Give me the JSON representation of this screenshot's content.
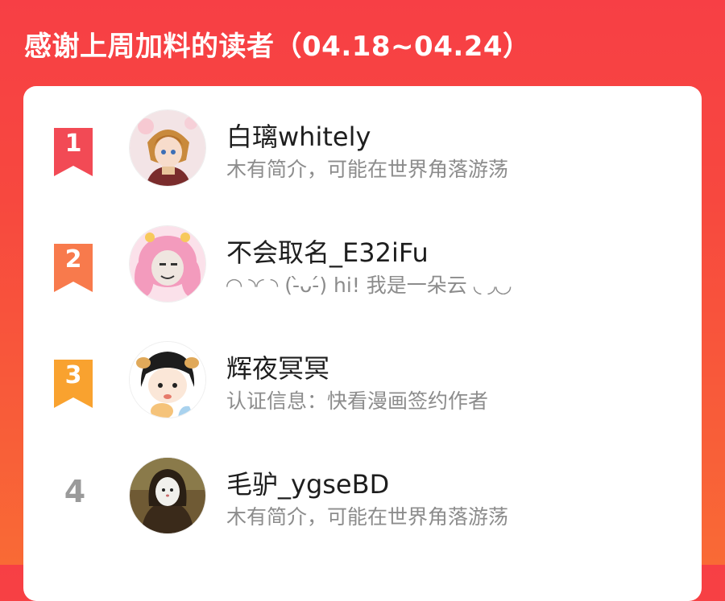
{
  "header": {
    "title": "感谢上周加料的读者（04.18~04.24）"
  },
  "colors": {
    "rank1": "#f24a55",
    "rank2": "#f87a4c",
    "rank3": "#f9a22f",
    "rank_plain": "#9a9a9a"
  },
  "readers": [
    {
      "rank": "1",
      "name": "白璃whitely",
      "desc": "木有简介，可能在世界角落游荡",
      "avatar_icon": "anime-boy-avatar"
    },
    {
      "rank": "2",
      "name": "不会取名_E32iFu",
      "desc": "◜◝ ◝◜ ◝ (-̀ᴗ-́) hi! 我是一朵云 ◟ ◞◟◞",
      "avatar_icon": "pink-meme-face-avatar"
    },
    {
      "rank": "3",
      "name": "辉夜冥冥",
      "desc": "认证信息：快看漫画签约作者",
      "avatar_icon": "chibi-girl-avatar"
    },
    {
      "rank": "4",
      "name": "毛驴_ygseBD",
      "desc": "木有简介，可能在世界角落游荡",
      "avatar_icon": "mona-lisa-ghost-avatar"
    }
  ]
}
